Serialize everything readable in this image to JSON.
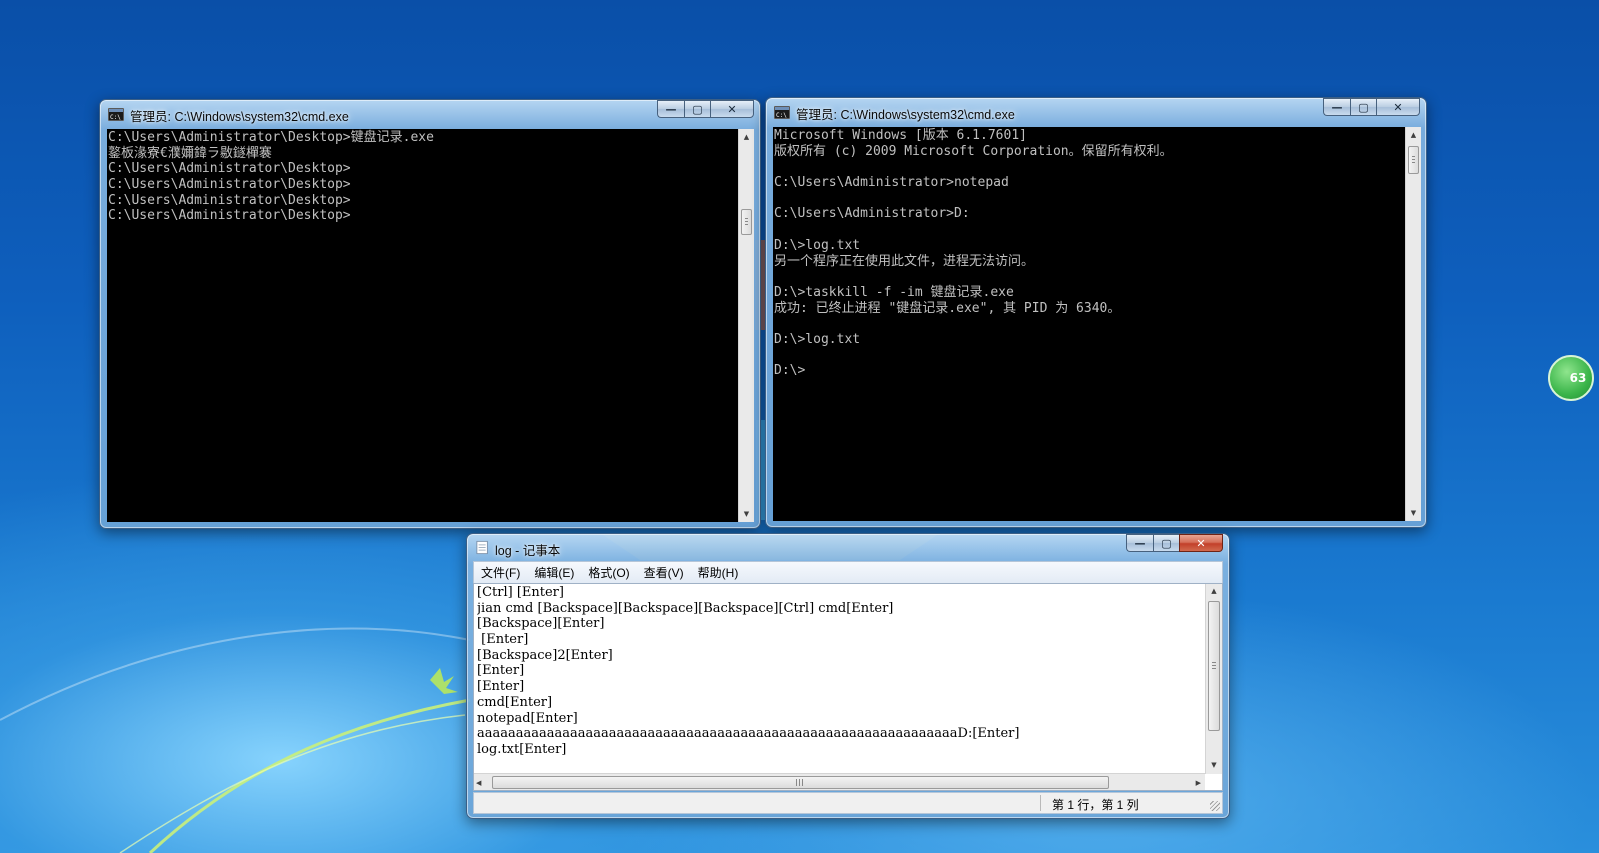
{
  "cmd_left": {
    "title": "管理员: C:\\Windows\\system32\\cmd.exe",
    "lines": [
      "C:\\Users\\Administrator\\Desktop>键盘记录.exe",
      "鐜板湪寮€濮嬭鍏ラ敭鐩樿褰",
      "C:\\Users\\Administrator\\Desktop>",
      "C:\\Users\\Administrator\\Desktop>",
      "C:\\Users\\Administrator\\Desktop>",
      "C:\\Users\\Administrator\\Desktop>"
    ]
  },
  "cmd_right": {
    "title": "管理员: C:\\Windows\\system32\\cmd.exe",
    "lines": [
      "Microsoft Windows [版本 6.1.7601]",
      "版权所有 (c) 2009 Microsoft Corporation。保留所有权利。",
      "",
      "C:\\Users\\Administrator>notepad",
      "",
      "C:\\Users\\Administrator>D:",
      "",
      "D:\\>log.txt",
      "另一个程序正在使用此文件，进程无法访问。",
      "",
      "D:\\>taskkill -f -im 键盘记录.exe",
      "成功: 已终止进程 \"键盘记录.exe\", 其 PID 为 6340。",
      "",
      "D:\\>log.txt",
      "",
      "D:\\>"
    ]
  },
  "notepad": {
    "title": "log - 记事本",
    "menu": [
      "文件(F)",
      "编辑(E)",
      "格式(O)",
      "查看(V)",
      "帮助(H)"
    ],
    "lines": [
      "[Ctrl] [Enter]",
      "jian cmd [Backspace][Backspace][Backspace][Ctrl] cmd[Enter]",
      "[Backspace][Enter]",
      " [Enter]",
      "[Backspace]2[Enter]",
      "[Enter]",
      "[Enter]",
      "cmd[Enter]",
      "notepad[Enter]",
      "aaaaaaaaaaaaaaaaaaaaaaaaaaaaaaaaaaaaaaaaaaaaaaaaaaaaaaaaaaaaaaD:[Enter]",
      "log.txt[Enter]"
    ],
    "status": "第 1 行，第 1 列"
  },
  "desktop_badge": "63",
  "icons": {
    "cmd": "cmd-window-icon",
    "notepad": "notepad-icon"
  }
}
